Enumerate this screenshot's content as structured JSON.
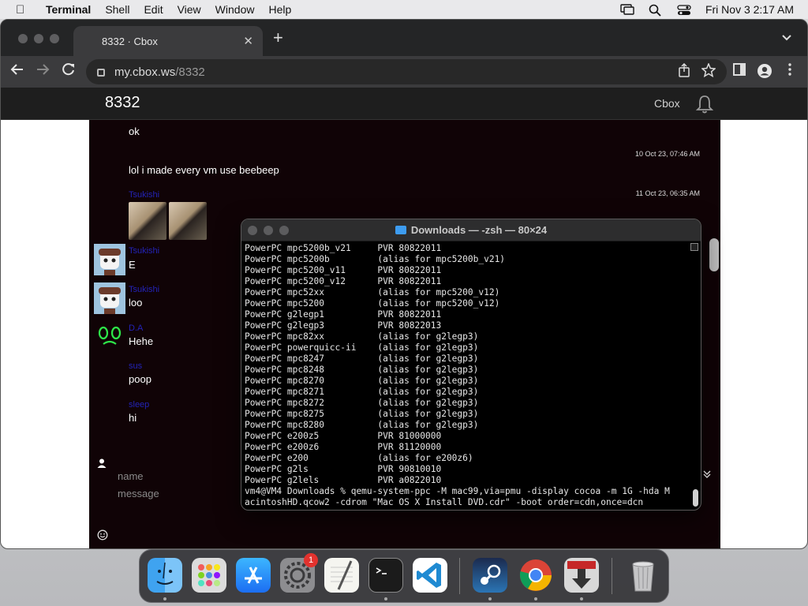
{
  "menubar": {
    "app_name": "Terminal",
    "items": [
      "Shell",
      "Edit",
      "View",
      "Window",
      "Help"
    ],
    "datetime": "Fri Nov 3  2:17 AM"
  },
  "browser": {
    "tab_title": "8332 · Cbox",
    "new_tab": "+",
    "tab_close": "✕",
    "url_host": "my.cbox.ws",
    "url_path": "/8332"
  },
  "cbox": {
    "room_title": "8332",
    "brand": "Cbox",
    "messages": [
      {
        "text": "ok"
      },
      {
        "time": "10 Oct 23, 07:46 AM",
        "text": "lol i made every vm use beebeep"
      },
      {
        "name": "Tsukishi",
        "time": "11 Oct 23, 06:35 AM"
      },
      {
        "name": "Tsukishi",
        "text": "E"
      },
      {
        "name": "Tsukishi",
        "text": "loo"
      },
      {
        "name": "D.A",
        "text": "Hehe"
      },
      {
        "name": "sus",
        "text": "poop"
      },
      {
        "name": "sleep",
        "text": "hi"
      }
    ],
    "input_name_placeholder": "name",
    "input_message_placeholder": "message"
  },
  "terminal": {
    "title": "Downloads — -zsh — 80×24",
    "lines": [
      "PowerPC mpc5200b_v21     PVR 80822011",
      "PowerPC mpc5200b         (alias for mpc5200b_v21)",
      "PowerPC mpc5200_v11      PVR 80822011",
      "PowerPC mpc5200_v12      PVR 80822011",
      "PowerPC mpc52xx          (alias for mpc5200_v12)",
      "PowerPC mpc5200          (alias for mpc5200_v12)",
      "PowerPC g2legp1          PVR 80822011",
      "PowerPC g2legp3          PVR 80822013",
      "PowerPC mpc82xx          (alias for g2legp3)",
      "PowerPC powerquicc-ii    (alias for g2legp3)",
      "PowerPC mpc8247          (alias for g2legp3)",
      "PowerPC mpc8248          (alias for g2legp3)",
      "PowerPC mpc8270          (alias for g2legp3)",
      "PowerPC mpc8271          (alias for g2legp3)",
      "PowerPC mpc8272          (alias for g2legp3)",
      "PowerPC mpc8275          (alias for g2legp3)",
      "PowerPC mpc8280          (alias for g2legp3)",
      "PowerPC e200z5           PVR 81000000",
      "PowerPC e200z6           PVR 81120000",
      "PowerPC e200             (alias for e200z6)",
      "PowerPC g2ls             PVR 90810010",
      "PowerPC g2lels           PVR a0822010",
      "vm4@VM4 Downloads % qemu-system-ppc -M mac99,via=pmu -display cocoa -m 1G -hda M",
      "acintoshHD.qcow2 -cdrom \"Mac OS X Install DVD.cdr\" -boot order=cdn,once=dcn"
    ]
  },
  "dock": {
    "apps": [
      "finder-icon",
      "launchpad-icon",
      "app-store-icon",
      "system-settings-icon",
      "textedit-icon",
      "terminal-icon",
      "vscode-icon",
      "steam-icon",
      "chrome-icon",
      "downloader-icon",
      "trash-icon"
    ],
    "settings_badge": "1"
  }
}
